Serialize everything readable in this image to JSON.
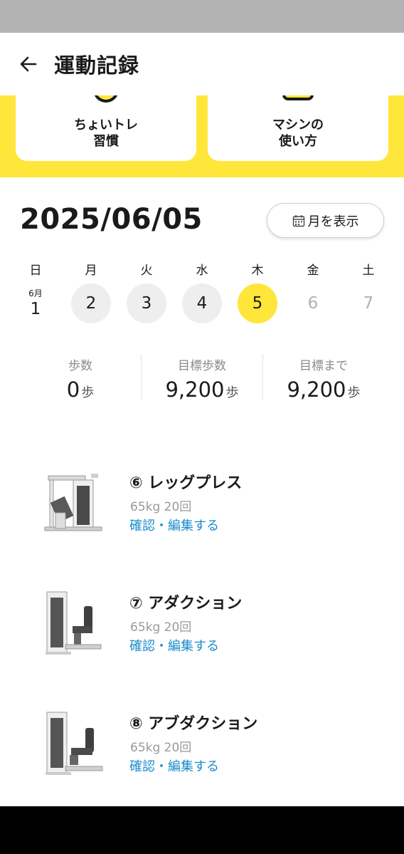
{
  "header": {
    "title": "運動記録",
    "back_icon": "arrow-left-icon"
  },
  "top_cards": [
    {
      "label": "ちょいトレ\n習慣",
      "icon": "chot-tore-icon"
    },
    {
      "label": "マシンの\n使い方",
      "icon": "machine-guide-icon"
    }
  ],
  "date": {
    "title": "2025/06/05",
    "month_button": "月を表示",
    "month_icon": "calendar-icon"
  },
  "week": [
    {
      "name": "日",
      "month": "6月",
      "num": "1",
      "state": "plain"
    },
    {
      "name": "月",
      "num": "2",
      "state": "past"
    },
    {
      "name": "火",
      "num": "3",
      "state": "past"
    },
    {
      "name": "水",
      "num": "4",
      "state": "past"
    },
    {
      "name": "木",
      "num": "5",
      "state": "today"
    },
    {
      "name": "金",
      "num": "6",
      "state": "future"
    },
    {
      "name": "土",
      "num": "7",
      "state": "future"
    }
  ],
  "steps": [
    {
      "label": "歩数",
      "value": "0",
      "unit": "歩"
    },
    {
      "label": "目標歩数",
      "value": "9,200",
      "unit": "歩"
    },
    {
      "label": "目標まで",
      "value": "9,200",
      "unit": "歩"
    }
  ],
  "machines": [
    {
      "title": "⑥ レッグプレス",
      "detail": "65kg 20回",
      "link": "確認・編集する",
      "image": "leg-press-machine"
    },
    {
      "title": "⑦ アダクション",
      "detail": "65kg 20回",
      "link": "確認・編集する",
      "image": "adduction-machine"
    },
    {
      "title": "⑧ アブダクション",
      "detail": "65kg 20回",
      "link": "確認・編集する",
      "image": "abduction-machine"
    }
  ],
  "colors": {
    "accent_yellow": "#ffe63a",
    "link_blue": "#1a8ccc",
    "muted_gray": "#9a9a9a"
  }
}
